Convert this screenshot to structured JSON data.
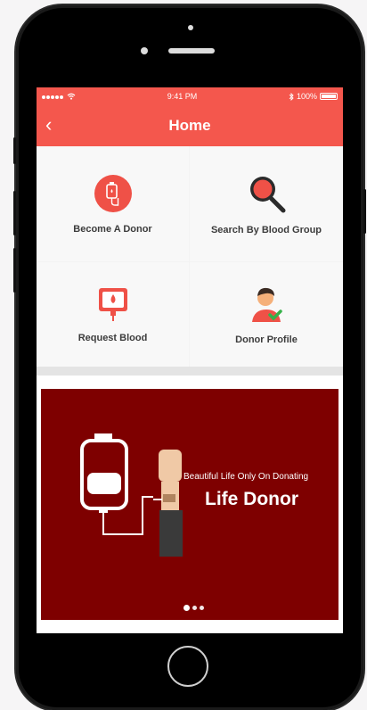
{
  "status_bar": {
    "time": "9:41 PM",
    "battery": "100%"
  },
  "header": {
    "title": "Home",
    "back_icon": "chevron-left-icon"
  },
  "tiles": [
    {
      "label": "Become A Donor",
      "icon": "blood-bag-icon"
    },
    {
      "label": "Search By Blood Group",
      "icon": "search-icon"
    },
    {
      "label": "Request Blood",
      "icon": "blood-request-icon"
    },
    {
      "label": "Donor Profile",
      "icon": "donor-profile-icon"
    }
  ],
  "banner": {
    "subtitle": "Beautiful Life Only On Donating",
    "title": "Life Donor",
    "page_count": 3,
    "active_page": 1
  },
  "colors": {
    "accent": "#f4574d",
    "banner_bg": "#7e0000"
  }
}
